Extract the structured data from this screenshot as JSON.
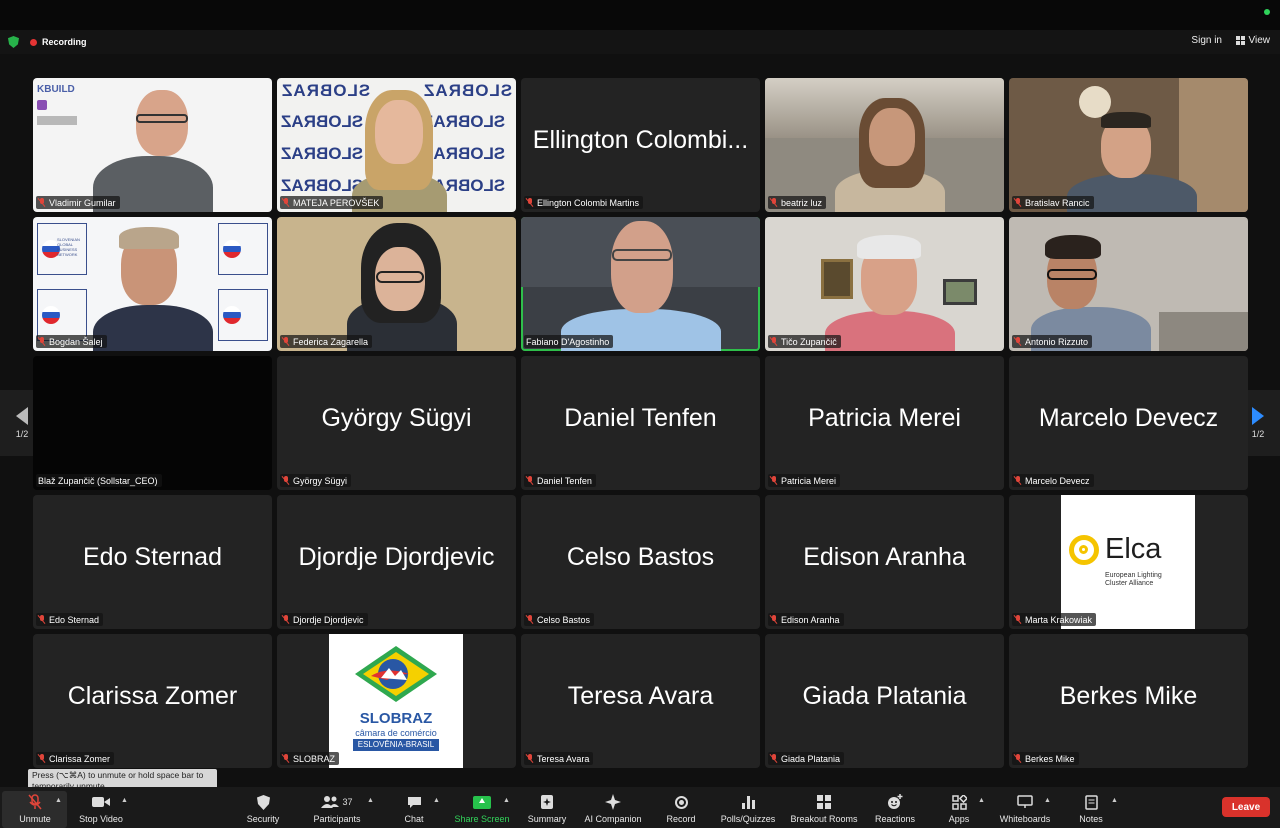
{
  "status": {
    "recording_label": "Recording",
    "signin_label": "Sign in",
    "view_label": "View"
  },
  "pagination": {
    "left": "1/2",
    "right": "1/2"
  },
  "tiles": [
    {
      "name": "Vladimir Gumilar"
    },
    {
      "name": "MATEJA PEROVŠEK"
    },
    {
      "name": "Ellington Colombi Martins",
      "big": "Ellington Colombi..."
    },
    {
      "name": "beatriz luz"
    },
    {
      "name": "Bratislav Rancic"
    },
    {
      "name": "Bogdan Šalej"
    },
    {
      "name": "Federica Zagarella"
    },
    {
      "name": "Fabiano D'Agostinho"
    },
    {
      "name": "Tičo Zupančič"
    },
    {
      "name": "Antonio Rizzuto"
    },
    {
      "name": "Blaž Zupančič (Sollstar_CEO)"
    },
    {
      "name": "György Sügyi",
      "big": "György Sügyi"
    },
    {
      "name": "Daniel Tenfen",
      "big": "Daniel Tenfen"
    },
    {
      "name": "Patricia Merei",
      "big": "Patricia Merei"
    },
    {
      "name": "Marcelo Devecz",
      "big": "Marcelo Devecz"
    },
    {
      "name": "Edo Sternad",
      "big": "Edo Sternad"
    },
    {
      "name": "Djordje Djordjevic",
      "big": "Djordje Djordjevic"
    },
    {
      "name": "Celso Bastos",
      "big": "Celso Bastos"
    },
    {
      "name": "Edison Aranha",
      "big": "Edison Aranha"
    },
    {
      "name": "Marta Krakowiak"
    },
    {
      "name": "Clarissa Zomer",
      "big": "Clarissa Zomer"
    },
    {
      "name": "SLOBRAZ"
    },
    {
      "name": "Teresa Avara",
      "big": "Teresa Avara"
    },
    {
      "name": "Giada Platania",
      "big": "Giada Platania"
    },
    {
      "name": "Berkes Mike",
      "big": "Berkes Mike"
    }
  ],
  "logos": {
    "kbuild": "KBUILD",
    "slobraz_banner": "SLOBRAZ",
    "sgbn": "SLOVENIAN GLOBAL BUSINESS NETWORK",
    "elca_name": "Elca",
    "elca_sub1": "European Lighting",
    "elca_sub2": "Cluster Alliance",
    "slobraz_name": "SLOBRAZ",
    "slobraz_sub": "câmara de comércio",
    "slobraz_band": "ESLOVÊNIA-BRASIL"
  },
  "tooltip": "Press  (⌥⌘A) to unmute or hold space bar to temporarily unmute.",
  "toolbar": {
    "unmute": "Unmute",
    "stop_video": "Stop Video",
    "security": "Security",
    "participants": "Participants",
    "participants_count": "37",
    "chat": "Chat",
    "share_screen": "Share Screen",
    "summary": "Summary",
    "ai_companion": "AI Companion",
    "record": "Record",
    "polls": "Polls/Quizzes",
    "breakout": "Breakout Rooms",
    "reactions": "Reactions",
    "apps": "Apps",
    "whiteboards": "Whiteboards",
    "notes": "Notes",
    "leave": "Leave"
  },
  "colors": {
    "accent_green": "#2fbf4b",
    "share_green": "#27c24c",
    "leave_red": "#d9322b",
    "nav_blue": "#2d8cff",
    "muted_red": "#e0453a"
  }
}
